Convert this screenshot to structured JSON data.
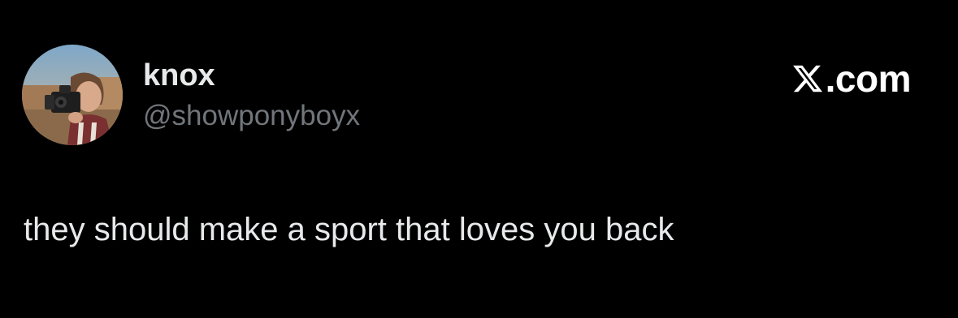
{
  "tweet": {
    "author": {
      "display_name": "knox",
      "handle": "@showponyboyx",
      "avatar_icon": "profile-photo-man-with-camera"
    },
    "text": "they should make a sport that loves you back"
  },
  "branding": {
    "logo_icon": "x-logo",
    "domain": ".com"
  },
  "colors": {
    "background": "#000000",
    "text_primary": "#e7e9ea",
    "text_secondary": "#71767b",
    "brand": "#ffffff"
  }
}
